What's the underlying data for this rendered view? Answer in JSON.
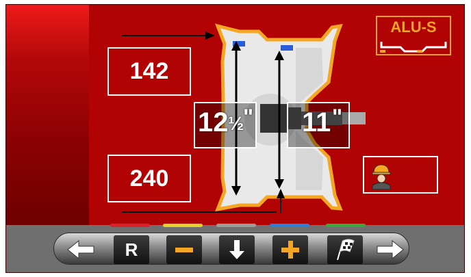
{
  "measurements": {
    "top_value": "142",
    "bottom_value": "240",
    "left_diameter_whole": "12",
    "left_diameter_fraction": "½",
    "left_diameter_unit": "\"",
    "right_diameter": "11",
    "right_diameter_unit": "\""
  },
  "mode_badge": {
    "label": "ALU-S",
    "color": "#f5a623"
  },
  "toolbar": {
    "color_tabs": [
      "#d8232a",
      "#e6d32a",
      "#9c9c9c",
      "#2a7fd8",
      "#3aa83a"
    ],
    "r_label": "R",
    "icons": [
      "arrow-left-icon",
      "minus-icon",
      "arrow-down-icon",
      "plus-icon",
      "checkered-flag-icon",
      "arrow-right-icon"
    ]
  },
  "colors": {
    "background": "#b20304",
    "accent_orange": "#f5a623",
    "accent_blue": "#2a5bd8"
  }
}
